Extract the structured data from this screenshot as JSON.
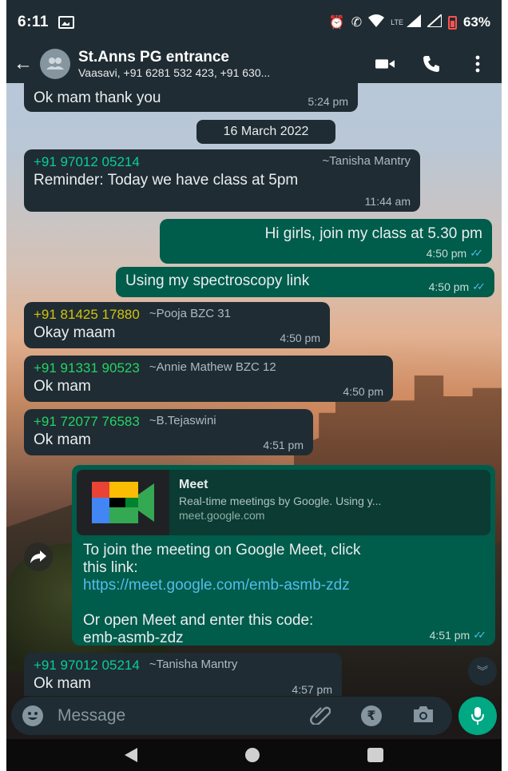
{
  "status_bar": {
    "time": "6:11",
    "battery": "63%",
    "network": "LTE"
  },
  "header": {
    "title": "St.Anns PG entrance",
    "subtitle": "Vaasavi, +91 6281 532 423, +91 630..."
  },
  "messages": [
    {
      "direction": "in",
      "text": "Ok mam thank you",
      "time": "5:24 pm"
    },
    {
      "type": "date",
      "text": "16 March 2022"
    },
    {
      "direction": "in",
      "sender": "+91 97012 05214",
      "nick": "~Tanisha Mantry",
      "sender_color": "#06cf9c",
      "text": "Reminder: Today we have class at 5pm",
      "time": "11:44 am"
    },
    {
      "direction": "out",
      "text": "Hi girls, join my class at 5.30 pm",
      "time": "4:50 pm"
    },
    {
      "direction": "out",
      "text": "Using my spectroscopy link",
      "time": "4:50 pm"
    },
    {
      "direction": "in",
      "sender": "+91 81425 17880",
      "nick": "~Pooja BZC 31",
      "sender_color": "#d4c20a",
      "text": "Okay maam",
      "time": "4:50 pm"
    },
    {
      "direction": "in",
      "sender": "+91 91331 90523",
      "nick": "~Annie Mathew BZC 12",
      "sender_color": "#25d366",
      "text": "Ok mam",
      "time": "4:50 pm"
    },
    {
      "direction": "in",
      "sender": "+91 72077 76583",
      "nick": "~B.Tejaswini",
      "sender_color": "#25d366",
      "text": "Ok mam",
      "time": "4:51 pm"
    },
    {
      "direction": "out",
      "preview": {
        "title": "Meet",
        "description": "Real-time meetings by Google. Using y...",
        "domain": "meet.google.com"
      },
      "line1": "To join the meeting on Google Meet, click",
      "line2": "this link:",
      "link": "https://meet.google.com/emb-asmb-zdz",
      "line3": "Or open Meet and enter this code:",
      "line4": "emb-asmb-zdz",
      "time": "4:51 pm"
    },
    {
      "direction": "in",
      "sender": "+91 97012 05214",
      "nick": "~Tanisha Mantry",
      "sender_color": "#06cf9c",
      "text": "Ok mam",
      "time": "4:57 pm"
    }
  ],
  "input": {
    "placeholder": "Message",
    "value": ""
  },
  "icons": {
    "payment": "₹"
  },
  "colors": {
    "incoming_bubble": "#1f2c33",
    "outgoing_bubble": "#005c4b",
    "accent": "#00a884",
    "read_ticks": "#53bdeb"
  }
}
